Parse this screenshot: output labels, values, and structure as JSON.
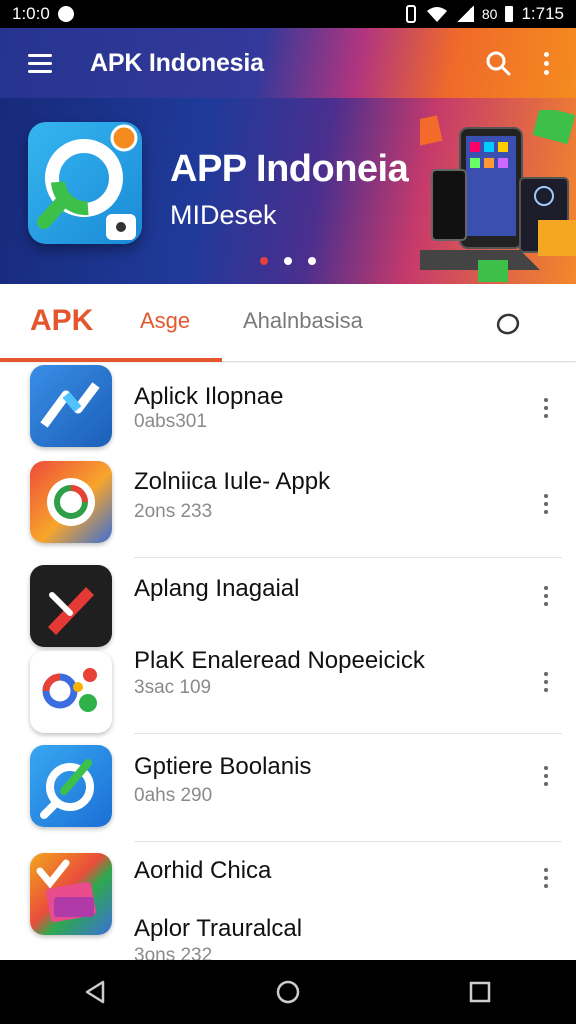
{
  "status_bar": {
    "time": "1:0:0",
    "right_text": "80",
    "clock": "1:715",
    "icons": [
      "notification-icon",
      "vibrate-icon",
      "wifi-icon",
      "signal-icon",
      "battery-icon"
    ]
  },
  "app_bar": {
    "title": "APK Indonesia",
    "icons": [
      "menu-icon",
      "search-icon",
      "more-vert-icon"
    ]
  },
  "banner": {
    "title": "APP Indoneia",
    "subtitle": "MIDesek",
    "slides": 3,
    "active_slide": 1
  },
  "tabs": {
    "items": [
      {
        "label": "APK",
        "active": true
      },
      {
        "label": "Asge"
      },
      {
        "label": "Ahalnbasisa"
      }
    ],
    "search_icon": "search-icon"
  },
  "apps": [
    {
      "name": "Aplick Ilopnae",
      "meta": "0abs301",
      "icon": "chart-arrow-icon"
    },
    {
      "name": "Zolniica Iule- Appk",
      "meta": "2ons 233",
      "icon": "chrome-like-icon"
    },
    {
      "name": "Aplang Inagaial",
      "meta": "",
      "icon": "pen-icon"
    },
    {
      "name": "PlaK Enaleread Nopeeicick",
      "meta": "3sac 109",
      "icon": "colorful-circles-icon"
    },
    {
      "name": "Gptiere Boolanis",
      "meta": "0ahs 290",
      "icon": "search-magnifier-icon"
    },
    {
      "name": "Aorhid Chica",
      "meta": "",
      "icon": "checkmark-book-icon"
    },
    {
      "name": "Aplor Trauralcal",
      "meta": "3ons 232",
      "icon": ""
    }
  ],
  "nav_bar": {
    "icons": [
      "back-icon",
      "home-icon",
      "recents-icon"
    ]
  },
  "colors": {
    "accent": "#e4572e",
    "app_bar_start": "#26348f",
    "app_bar_end": "#f58b1f"
  }
}
